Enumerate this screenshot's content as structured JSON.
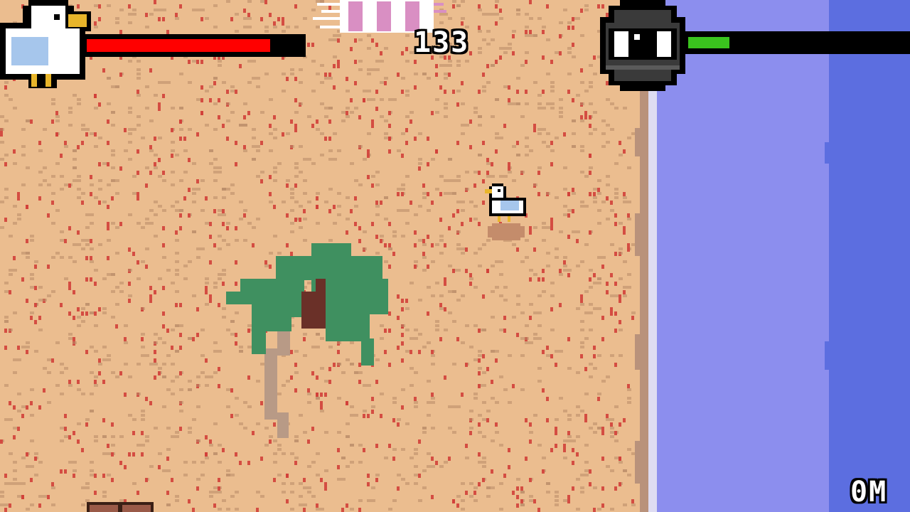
{
  "hud": {
    "score": "133",
    "distance": "0M",
    "health_fraction": 0.85,
    "stealth_fraction": 0.19,
    "health_color": "#ff0000",
    "stealth_color": "#3ac41e"
  },
  "scene": {
    "sand_color": "#ebbd8f",
    "sand_speck_red": "#d2403a",
    "sand_speck_brown": "#b88a68",
    "shore_color": "#b9927b",
    "foam_color": "#dedcf2",
    "shallow_water": "#8c8eee",
    "deep_water": "#5c6ee0",
    "palm_leaf": "#3f9060",
    "palm_trunk": "#b89a86",
    "palm_core": "#6a3028"
  },
  "icons": {
    "player_portrait": "seagull-icon",
    "watcher_portrait": "eye-icon",
    "player_sprite": "seagull-sprite",
    "towel": "beach-towel",
    "tree": "palm-tree",
    "crate": "wooden-crate"
  }
}
